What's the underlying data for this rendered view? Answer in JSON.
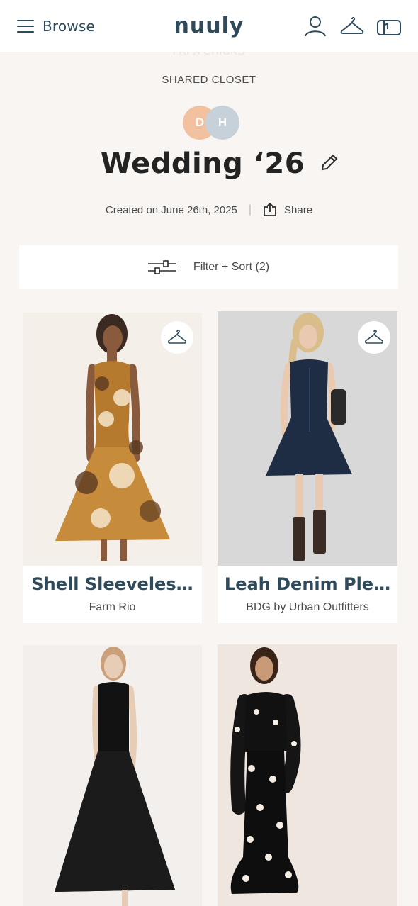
{
  "header": {
    "browse_label": "Browse",
    "logo": "nuuly"
  },
  "closet": {
    "faded_header": "PAPA CHICKS",
    "eyebrow": "SHARED CLOSET",
    "members": [
      "D",
      "H"
    ],
    "title": "Wedding ‘26",
    "created": "Created on June 26th, 2025",
    "separator": "|",
    "share_label": "Share"
  },
  "filter": {
    "label": "Filter + Sort (2)"
  },
  "products": [
    {
      "name": "Shell Sleeveles…",
      "brand": "Farm Rio"
    },
    {
      "name": "Leah Denim Ple…",
      "brand": "BDG by Urban Outfitters"
    },
    {
      "name": "",
      "brand": ""
    },
    {
      "name": "",
      "brand": ""
    }
  ],
  "colors": {
    "brand_navy": "#2e4a5b",
    "background": "#f8f5f2",
    "avatar_d": "#f2c1a0",
    "avatar_h": "#c7d1da"
  }
}
